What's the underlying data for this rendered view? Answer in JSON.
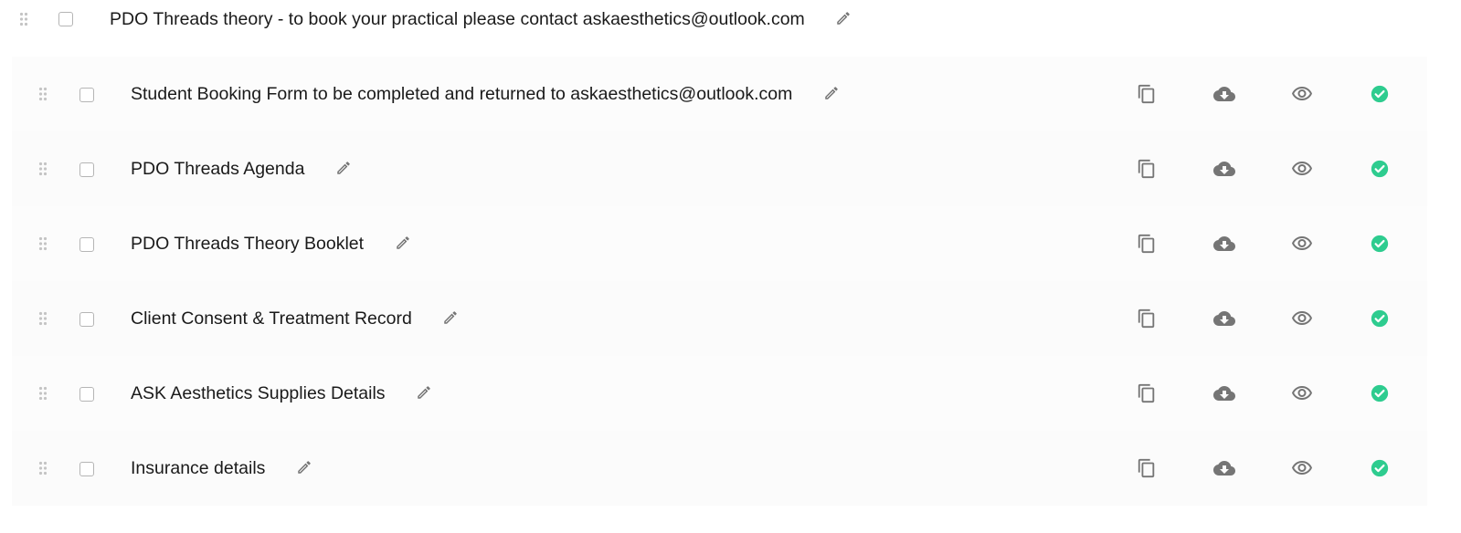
{
  "section": {
    "title": "PDO Threads theory - to book your practical please contact askaesthetics@outlook.com",
    "icons": {
      "drag": "drag-handle-icon",
      "edit": "pencil-icon"
    }
  },
  "items": [
    {
      "title": "Student Booking Form to be completed and returned to askaesthetics@outlook.com",
      "status": "completed"
    },
    {
      "title": "PDO Threads Agenda",
      "status": "completed"
    },
    {
      "title": "PDO Threads Theory Booklet",
      "status": "completed"
    },
    {
      "title": "Client Consent & Treatment Record",
      "status": "completed"
    },
    {
      "title": "ASK Aesthetics Supplies Details",
      "status": "completed"
    },
    {
      "title": "Insurance details",
      "status": "completed"
    }
  ],
  "row_actions": [
    "copy-icon",
    "cloud-download-icon",
    "eye-icon",
    "check-circle-icon"
  ],
  "colors": {
    "icon_gray": "#757575",
    "handle_gray": "#c4c4c4",
    "success_green": "#2ecc8f",
    "row_bg": "#fcfcfc"
  }
}
